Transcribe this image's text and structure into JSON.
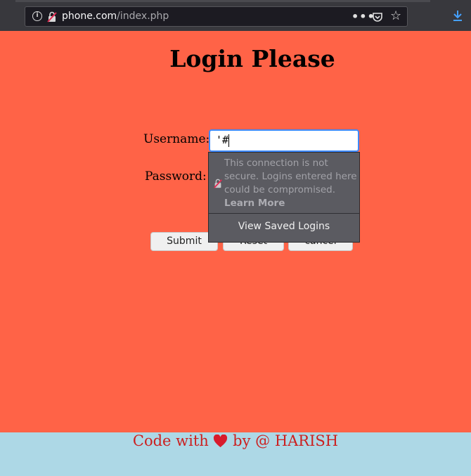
{
  "browser": {
    "url_domain": "phone.com",
    "url_path": "/index.php",
    "icons": [
      "info-icon",
      "insecure-lock-icon",
      "more-icon",
      "pocket-icon",
      "star-icon",
      "download-icon"
    ]
  },
  "page": {
    "title": "Login Please",
    "username_label": "Username:",
    "username_value": "'#",
    "password_label": "Password:",
    "buttons": {
      "submit": "Submit",
      "reset": "Reset",
      "cancel": "cancel"
    }
  },
  "popup": {
    "message": "This connection is not secure. Logins entered here could be compromised.",
    "learn_more": "Learn More",
    "view_saved": "View Saved Logins"
  },
  "footer": {
    "prefix": "Code with",
    "suffix": "by @ HARISH",
    "heart_color": "#cc1f1f"
  },
  "colors": {
    "page_background": "#ff6347",
    "footer_background": "#add8e6",
    "focus_border": "#3d8aff"
  }
}
